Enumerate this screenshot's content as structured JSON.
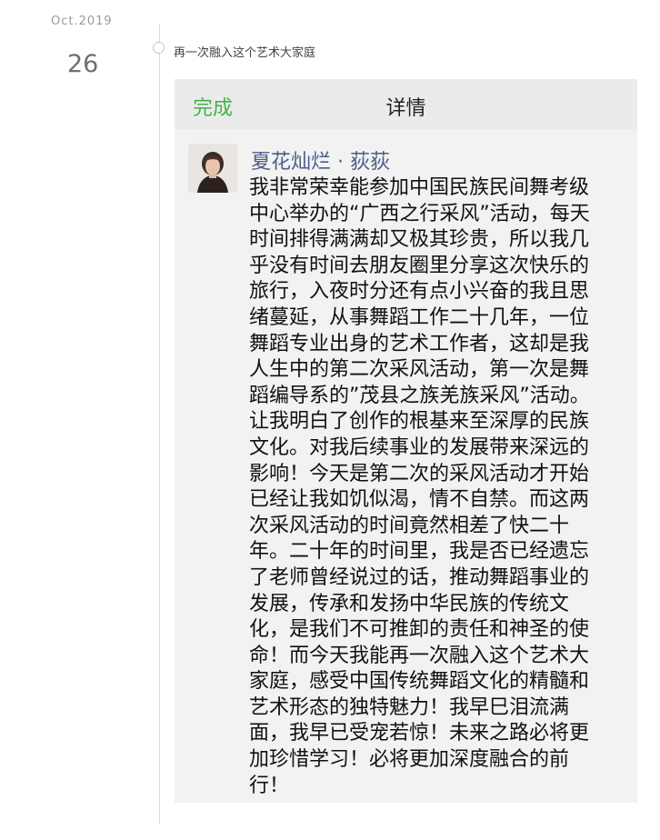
{
  "timeline": {
    "month": "Oct.2019",
    "day": "26",
    "title": "再一次融入这个艺术大家庭"
  },
  "navbar": {
    "done_label": "完成",
    "title": "详情",
    "done_color": "#3fb64a"
  },
  "post": {
    "author": "夏花灿烂 · 荻荻",
    "author_color": "#4d5d8a",
    "lines": [
      "我非常荣幸能参加中国民族民间舞考级",
      "中心举办的“广西之行采风”活动，每天",
      "时间排得满满却又极其珍贵，所以我几",
      "乎没有时间去朋友圈里分享这次快乐的",
      "旅行，入夜时分还有点小兴奋的我且思",
      "绪蔓延，从事舞蹈工作二十几年，一位",
      "舞蹈专业出身的艺术工作者，这却是我",
      "人生中的第二次采风活动，第一次是舞",
      "蹈编导系的”茂县之族羌族采风”活动。",
      "让我明白了创作的根基来至深厚的民族",
      "文化。对我后续事业的发展带来深远的",
      "影响！今天是第二次的采风活动才开始",
      "已经让我如饥似渴，情不自禁。而这两",
      "次采风活动的时间竟然相差了快二十",
      "年。二十年的时间里，我是否已经遗忘",
      "了老师曾经说过的话，推动舞蹈事业的",
      "发展，传承和发扬中华民族的传统文",
      "化，是我们不可推卸的责任和神圣的使",
      "命！而今天我能再一次融入这个艺术大",
      "家庭，感受中国传统舞蹈文化的精髓和",
      "艺术形态的独特魅力！我早巳泪流满",
      "面，我早已受宠若惊！未来之路必将更",
      "加珍惜学习！必将更加深度融合的前",
      "行！"
    ]
  }
}
